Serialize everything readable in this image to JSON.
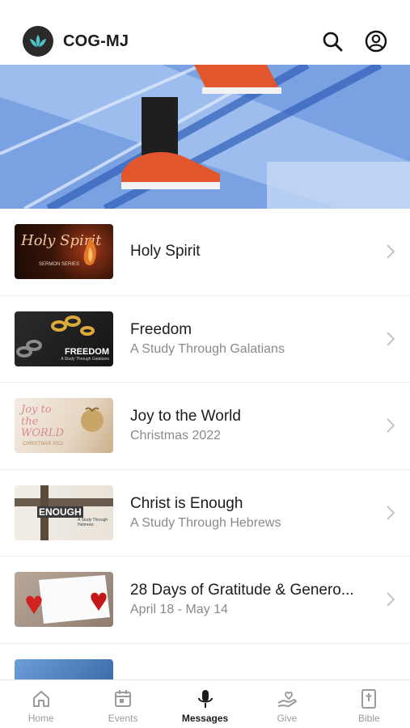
{
  "app": {
    "title": "COG-MJ"
  },
  "series": [
    {
      "title": "Holy Spirit",
      "subtitle": "",
      "thumb_text": "Holy Spirit",
      "thumb_sub": "SERMON SERIES"
    },
    {
      "title": "Freedom",
      "subtitle": "A Study Through Galatians",
      "thumb_text": "FREEDOM",
      "thumb_sub": "A Study Through Galatians"
    },
    {
      "title": "Joy to the World",
      "subtitle": "Christmas 2022",
      "thumb_text": "Joy to the WORLD",
      "thumb_sub": "CHRISTMAS 2022"
    },
    {
      "title": "Christ is Enough",
      "subtitle": "A Study Through Hebrews",
      "thumb_text": "ENOUGH",
      "thumb_sub": "A Study Through Hebrews"
    },
    {
      "title": "28 Days of Gratitude & Genero...",
      "subtitle": "April 18 - May 14",
      "thumb_text": "",
      "thumb_sub": ""
    }
  ],
  "tabs": [
    {
      "label": "Home",
      "icon": "home-icon"
    },
    {
      "label": "Events",
      "icon": "calendar-icon"
    },
    {
      "label": "Messages",
      "icon": "microphone-icon",
      "active": true
    },
    {
      "label": "Give",
      "icon": "give-icon"
    },
    {
      "label": "Bible",
      "icon": "bible-icon"
    }
  ],
  "colors": {
    "accent": "#1c1c1e",
    "muted": "#9a9a9e",
    "logo_teal": "#4fc3c9"
  }
}
